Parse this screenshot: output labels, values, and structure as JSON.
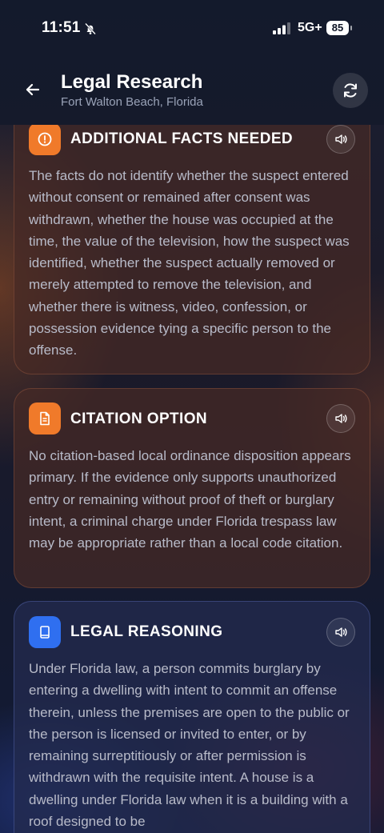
{
  "status_bar": {
    "time": "11:51",
    "network": "5G+",
    "battery": "85",
    "icons": [
      "bell-slash-icon",
      "signal-icon"
    ]
  },
  "header": {
    "title": "Legal Research",
    "location": "Fort Walton Beach, Florida",
    "icons": [
      "back-arrow-icon",
      "refresh-icon"
    ]
  },
  "cards": [
    {
      "title": "ADDITIONAL FACTS NEEDED",
      "icon": "alert-circle-icon",
      "accent": "#f07a2a",
      "body": "The facts do not identify whether the suspect entered without consent or remained after consent was withdrawn, whether the house was occupied at the time, the value of the television, how the suspect was identified, whether the suspect actually removed or merely attempted to remove the television, and whether there is witness, video, confession, or possession evidence tying a specific person to the offense."
    },
    {
      "title": "CITATION OPTION",
      "icon": "document-icon",
      "accent": "#f07a2a",
      "body": "No citation-based local ordinance disposition appears primary. If the evidence only supports unauthorized entry or remaining without proof of theft or burglary intent, a criminal charge under Florida trespass law may be appropriate rather than a local code citation."
    },
    {
      "title": "LEGAL REASONING",
      "icon": "book-icon",
      "accent": "#2f6ff0",
      "body": "Under Florida law, a person commits burglary by entering a dwelling with intent to commit an offense therein, unless the premises are open to the public or the person is licensed or invited to enter, or by remaining surreptitiously or after permission is withdrawn with the requisite intent. A house is a dwelling under Florida law when it is a building with a roof designed to be"
    }
  ]
}
